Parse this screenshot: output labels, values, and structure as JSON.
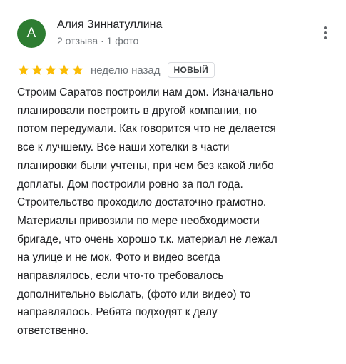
{
  "review": {
    "author": {
      "initial": "А",
      "name": "Алия Зиннатуллина",
      "stats": "2 отзыва · 1 фото",
      "avatar_color": "#2e7d32"
    },
    "rating": {
      "stars": 5,
      "max": 5,
      "star_color": "#fbbc04"
    },
    "date": "неделю назад",
    "badge": "НОВЫЙ",
    "lines": [
      "Строим Саратов построили нам дом. Изначально",
      "планировали построить в другой компании, но",
      "потом передумали. Как говорится что не делается",
      "все к лучшему. Все наши хотелки в части",
      "планировки были учтены, при чем без какой либо",
      "доплаты. Дом построили ровно за пол года.",
      "Строительство проходило достаточно грамотно.",
      "Материалы привозили по мере необходимости",
      "бригаде, что очень хорошо т.к. материал не лежал",
      "на улице и не мок. Фото и видео всегда",
      "направлялось, если что-то требовалось",
      "дополнительно выслать, (фото или видео) то",
      "направлялось. Ребята подходят к делу",
      "ответственно."
    ]
  }
}
